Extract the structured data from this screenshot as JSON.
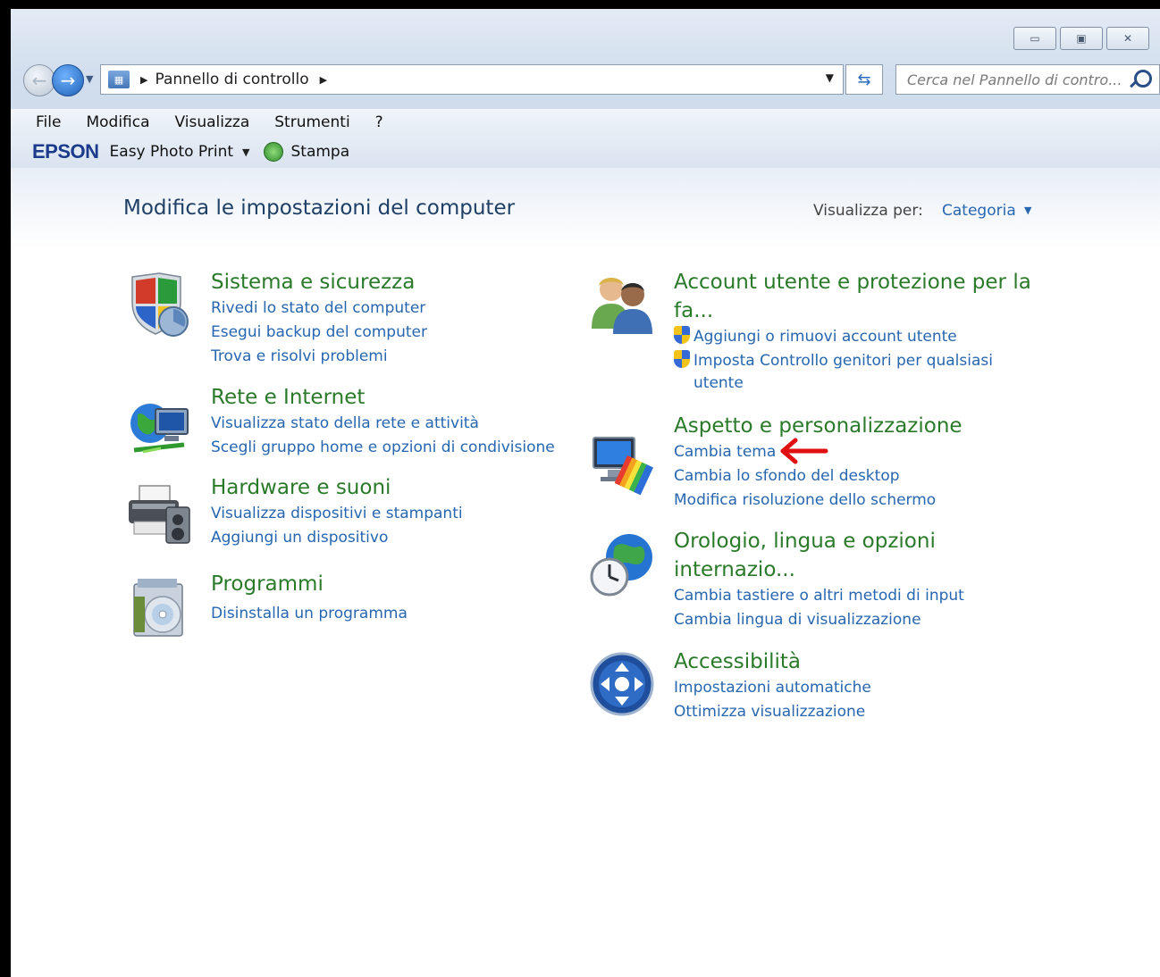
{
  "window": {
    "controls": {
      "minimize": "▭",
      "maximize": "▣",
      "close": "✕"
    }
  },
  "navigation": {
    "breadcrumb": "Pannello di controllo",
    "search_placeholder": "Cerca nel Pannello di contro..."
  },
  "menu": [
    "File",
    "Modifica",
    "Visualizza",
    "Strumenti",
    "?"
  ],
  "toolbar": {
    "brand": "EPSON",
    "app": "Easy Photo Print",
    "print": "Stampa"
  },
  "page": {
    "title": "Modifica le impostazioni del computer",
    "view_by_label": "Visualizza per:",
    "view_by_value": "Categoria"
  },
  "categories_left": [
    {
      "title": "Sistema e sicurezza",
      "icon": "shield-icon",
      "links": [
        "Rivedi lo stato del computer",
        "Esegui backup del computer",
        "Trova e risolvi problemi"
      ]
    },
    {
      "title": "Rete e Internet",
      "icon": "network-globe-icon",
      "links": [
        "Visualizza stato della rete e attività",
        "Scegli gruppo home e opzioni di condivisione"
      ]
    },
    {
      "title": "Hardware e suoni",
      "icon": "printer-speaker-icon",
      "links": [
        "Visualizza dispositivi e stampanti",
        "Aggiungi un dispositivo"
      ]
    },
    {
      "title": "Programmi",
      "icon": "programs-disc-icon",
      "links": [
        "Disinstalla un programma"
      ]
    }
  ],
  "categories_right": [
    {
      "title_line1": "Account utente e protezione per la",
      "title_line2": "fa...",
      "icon": "user-accounts-icon",
      "links": [
        "Aggiungi o rimuovi account utente",
        "Imposta Controllo genitori per qualsiasi",
        "utente"
      ]
    },
    {
      "title": "Aspetto e personalizzazione",
      "icon": "appearance-monitor-icon",
      "links": [
        "Cambia tema",
        "Cambia lo sfondo del desktop",
        "Modifica risoluzione dello schermo"
      ]
    },
    {
      "title_line1": "Orologio, lingua e opzioni",
      "title_line2": "internazio...",
      "icon": "clock-globe-icon",
      "links": [
        "Cambia tastiere o altri metodi di input",
        "Cambia lingua di visualizzazione"
      ]
    },
    {
      "title": "Accessibilità",
      "icon": "accessibility-icon",
      "links": [
        "Impostazioni automatiche",
        "Ottimizza visualizzazione"
      ]
    }
  ],
  "colors": {
    "title_green": "#2a7a2a",
    "link_blue": "#2766b0",
    "heading": "#1e3f66",
    "annotation_red": "#e01010"
  }
}
